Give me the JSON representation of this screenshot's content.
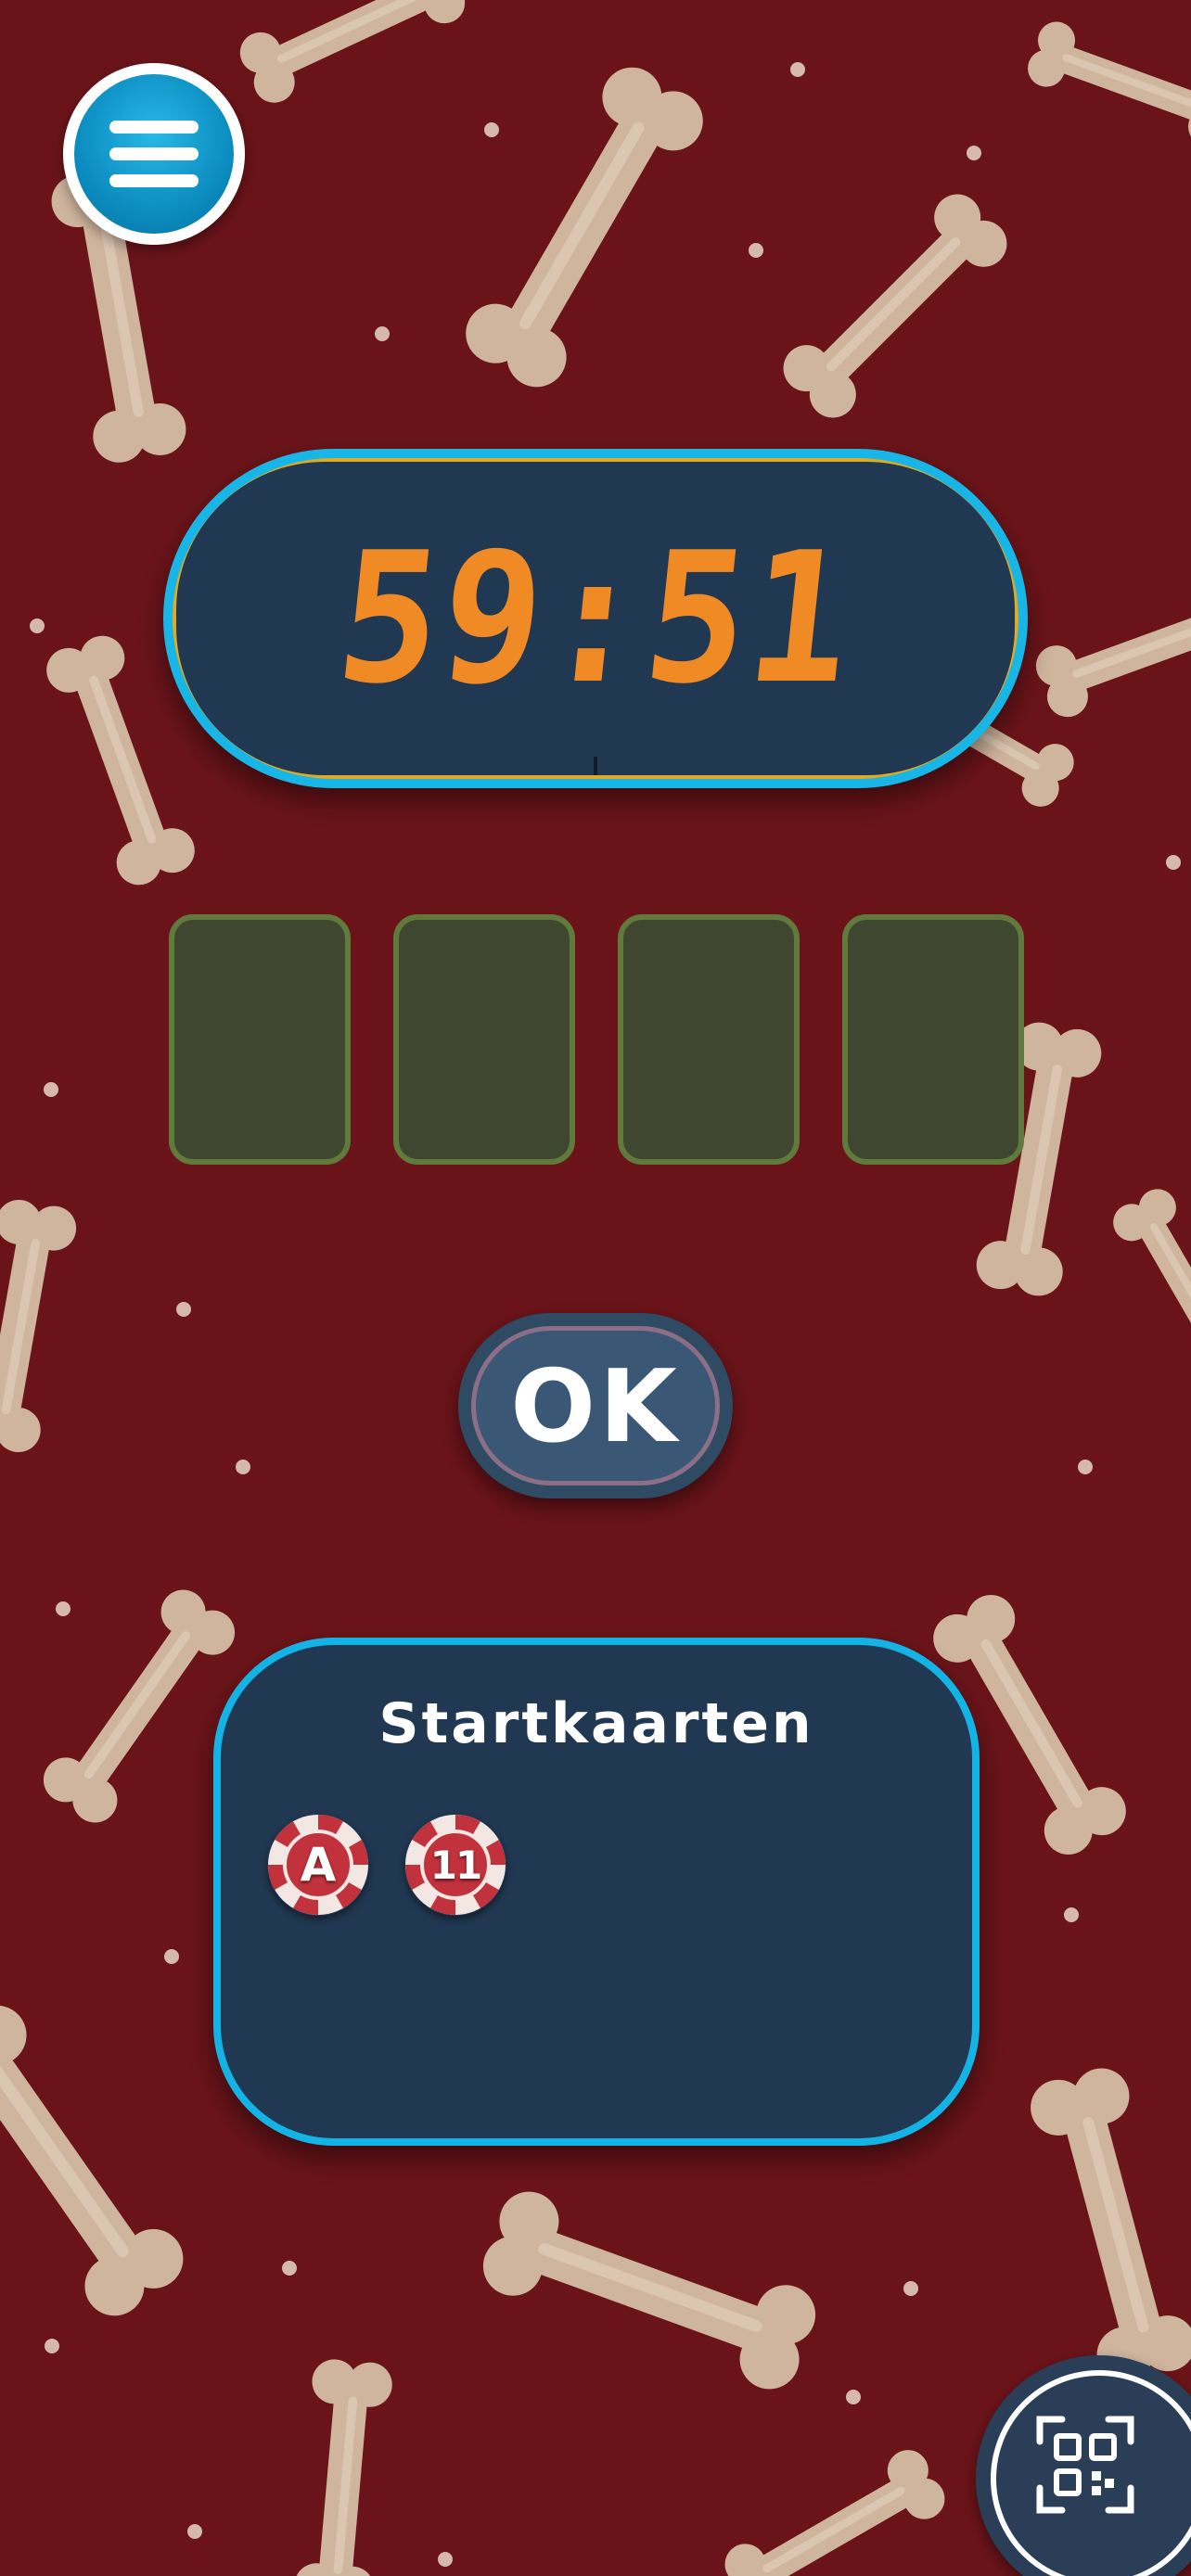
{
  "app": {
    "background_color": "#6a1419",
    "background_pattern": "bones"
  },
  "header": {
    "menu_icon": "hamburger-menu-icon"
  },
  "timer": {
    "display": "59:51",
    "digit_color": "#f08a24",
    "frame_color": "#18b6e6",
    "bezel_color": "#e0aa22"
  },
  "answer_slots": {
    "count": 4,
    "slot_color": "#3f4731",
    "border_color": "#5f7a3a"
  },
  "ok_button": {
    "label": "OK"
  },
  "start_cards": {
    "title": "Startkaarten",
    "chips": [
      {
        "label": "A"
      },
      {
        "label": "11"
      }
    ]
  },
  "footer": {
    "qr_icon": "qr-scan-icon"
  }
}
